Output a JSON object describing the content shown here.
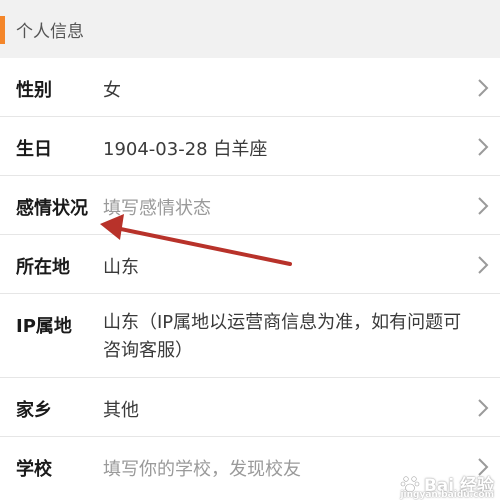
{
  "section": {
    "title": "个人信息",
    "accent_color": "#f4862a"
  },
  "rows": [
    {
      "label": "性别",
      "value": "女",
      "placeholder": false
    },
    {
      "label": "生日",
      "value": "1904-03-28 白羊座",
      "placeholder": false
    },
    {
      "label": "感情状况",
      "value": "填写感情状态",
      "placeholder": true
    },
    {
      "label": "所在地",
      "value": "山东",
      "placeholder": false
    },
    {
      "label": "IP属地",
      "value": "山东（IP属地以运营商信息为准，如有问题可咨询客服）",
      "placeholder": false
    },
    {
      "label": "家乡",
      "value": "其他",
      "placeholder": false
    },
    {
      "label": "学校",
      "value": "填写你的学校，发现校友",
      "placeholder": true
    }
  ],
  "icons": {
    "row_chevron": "chevron-right-icon",
    "annotation": "red-arrow-icon",
    "watermark": "baidu-paw-icon"
  },
  "annotation": {
    "color": "#b8322a"
  },
  "watermark": {
    "text": "Bai 经验",
    "sub": "jingyan.baidu.com"
  }
}
